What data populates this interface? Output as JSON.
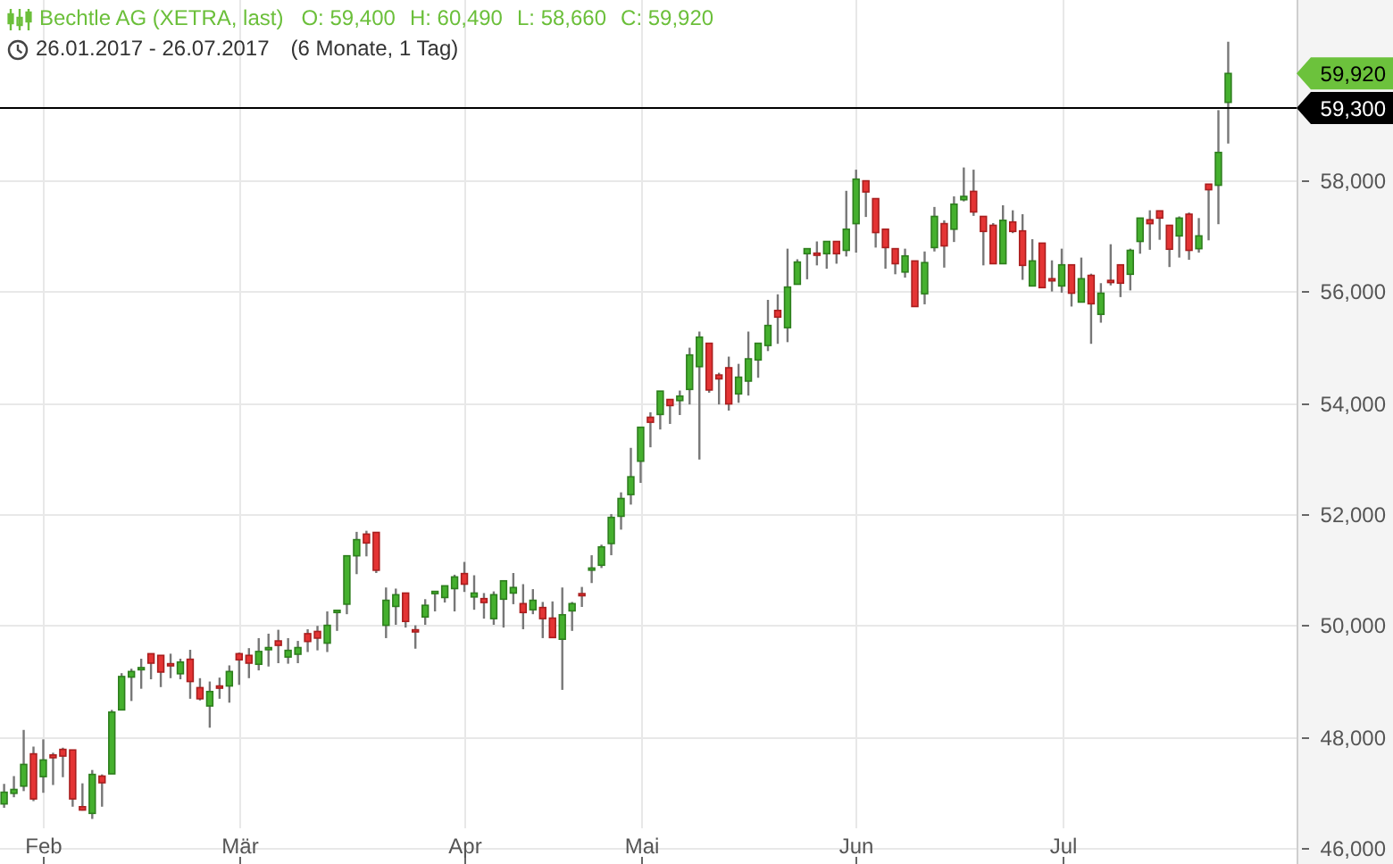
{
  "header": {
    "title": "Bechtle AG (XETRA, last)",
    "quotes": [
      "O: 59,400",
      "H: 60,490",
      "L: 58,660",
      "C: 59,920"
    ],
    "range": "26.01.2017 - 26.07.2017",
    "period": "(6 Monate, 1 Tag)"
  },
  "chart": {
    "chart_data": {
      "type": "candlestick",
      "grid": true,
      "ylim": [
        45710,
        61240
      ],
      "yticks": [
        {
          "value": 46000,
          "label": "46,000"
        },
        {
          "value": 48000,
          "label": "48,000"
        },
        {
          "value": 50000,
          "label": "50,000"
        },
        {
          "value": 52000,
          "label": "52,000"
        },
        {
          "value": 54000,
          "label": "54,000"
        },
        {
          "value": 56000,
          "label": "56,000"
        },
        {
          "value": 58000,
          "label": "58,000"
        }
      ],
      "categories": [
        null,
        null,
        null,
        null,
        "Feb",
        null,
        null,
        null,
        null,
        null,
        null,
        null,
        null,
        null,
        null,
        null,
        null,
        null,
        null,
        null,
        null,
        null,
        null,
        null,
        "Mär",
        null,
        null,
        null,
        null,
        null,
        null,
        null,
        null,
        null,
        null,
        null,
        null,
        null,
        null,
        null,
        null,
        null,
        null,
        null,
        null,
        null,
        null,
        "Apr",
        null,
        null,
        null,
        null,
        null,
        null,
        null,
        null,
        null,
        null,
        null,
        null,
        null,
        null,
        null,
        null,
        null,
        "Mai",
        null,
        null,
        null,
        null,
        null,
        null,
        null,
        null,
        null,
        null,
        null,
        null,
        null,
        null,
        null,
        null,
        null,
        null,
        null,
        null,
        null,
        "Jun",
        null,
        null,
        null,
        null,
        null,
        null,
        null,
        null,
        null,
        null,
        null,
        null,
        null,
        null,
        null,
        null,
        null,
        null,
        null,
        null,
        "Jul",
        null,
        null,
        null,
        null,
        null,
        null,
        null,
        null,
        null,
        null,
        null,
        null,
        null,
        null,
        null,
        null,
        null
      ],
      "ohlc": [
        [
          46790,
          47150,
          46720,
          47000
        ],
        [
          46980,
          47290,
          46910,
          47050
        ],
        [
          47110,
          48120,
          47020,
          47500
        ],
        [
          47690,
          47820,
          46840,
          46880
        ],
        [
          47280,
          47950,
          46990,
          47580
        ],
        [
          47670,
          47710,
          47130,
          47620
        ],
        [
          47770,
          47800,
          47270,
          47650
        ],
        [
          47760,
          47760,
          46740,
          46880
        ],
        [
          46740,
          47160,
          46670,
          46680
        ],
        [
          46620,
          47400,
          46520,
          47320
        ],
        [
          47290,
          47320,
          46740,
          47170
        ],
        [
          47330,
          48480,
          47330,
          48440
        ],
        [
          48480,
          49140,
          48480,
          49080
        ],
        [
          49070,
          49220,
          48640,
          49170
        ],
        [
          49220,
          49400,
          48860,
          49240
        ],
        [
          49490,
          49490,
          49030,
          49320
        ],
        [
          49460,
          49460,
          48890,
          49160
        ],
        [
          49310,
          49490,
          49050,
          49290
        ],
        [
          49130,
          49400,
          49030,
          49340
        ],
        [
          49390,
          49560,
          48680,
          48990
        ],
        [
          48880,
          49050,
          48650,
          48680
        ],
        [
          48550,
          48990,
          48160,
          48810
        ],
        [
          48910,
          49060,
          48680,
          48870
        ],
        [
          48910,
          49280,
          48610,
          49170
        ],
        [
          49490,
          49510,
          48930,
          49380
        ],
        [
          49460,
          49590,
          49050,
          49320
        ],
        [
          49300,
          49770,
          49190,
          49530
        ],
        [
          49580,
          49850,
          49260,
          49600
        ],
        [
          49720,
          49920,
          49320,
          49640
        ],
        [
          49430,
          49770,
          49310,
          49550
        ],
        [
          49480,
          49720,
          49320,
          49600
        ],
        [
          49850,
          49930,
          49520,
          49710
        ],
        [
          49890,
          49990,
          49550,
          49770
        ],
        [
          49680,
          50250,
          49520,
          50000
        ],
        [
          50230,
          50270,
          49900,
          50270
        ],
        [
          50380,
          51250,
          50200,
          51250
        ],
        [
          51250,
          51680,
          50920,
          51540
        ],
        [
          51640,
          51700,
          51240,
          51480
        ],
        [
          51670,
          51670,
          50940,
          50990
        ],
        [
          50000,
          50680,
          49770,
          50450
        ],
        [
          50340,
          50660,
          50010,
          50550
        ],
        [
          50580,
          50580,
          49960,
          50070
        ],
        [
          49920,
          50000,
          49580,
          49900
        ],
        [
          50150,
          50470,
          50010,
          50360
        ],
        [
          50570,
          50610,
          50250,
          50610
        ],
        [
          50500,
          50710,
          50410,
          50710
        ],
        [
          50660,
          50910,
          50250,
          50870
        ],
        [
          50930,
          51140,
          50600,
          50740
        ],
        [
          50510,
          50900,
          50280,
          50580
        ],
        [
          50480,
          50580,
          50120,
          50410
        ],
        [
          50120,
          50610,
          50010,
          50550
        ],
        [
          50470,
          50800,
          49960,
          50800
        ],
        [
          50580,
          50940,
          50380,
          50680
        ],
        [
          50390,
          50740,
          49930,
          50230
        ],
        [
          50280,
          50650,
          50200,
          50450
        ],
        [
          50320,
          50420,
          49770,
          50120
        ],
        [
          50130,
          50430,
          49780,
          49780
        ],
        [
          49750,
          50680,
          48840,
          50190
        ],
        [
          50260,
          50420,
          49900,
          50390
        ],
        [
          50570,
          50690,
          50330,
          50550
        ],
        [
          51000,
          51260,
          50760,
          51030
        ],
        [
          51080,
          51450,
          51030,
          51410
        ],
        [
          51470,
          52000,
          51260,
          51940
        ],
        [
          51960,
          52390,
          51720,
          52280
        ],
        [
          52350,
          53190,
          52170,
          52670
        ],
        [
          52950,
          53560,
          52560,
          53560
        ],
        [
          53740,
          53830,
          53200,
          53650
        ],
        [
          53790,
          54210,
          53520,
          54210
        ],
        [
          54060,
          54060,
          53620,
          53950
        ],
        [
          54040,
          54220,
          53780,
          54120
        ],
        [
          54240,
          54990,
          53970,
          54860
        ],
        [
          54650,
          55280,
          52980,
          55180
        ],
        [
          55070,
          55070,
          54180,
          54230
        ],
        [
          54500,
          54540,
          53970,
          54430
        ],
        [
          54630,
          54830,
          53860,
          53980
        ],
        [
          54160,
          54700,
          54000,
          54460
        ],
        [
          54390,
          55280,
          54130,
          54790
        ],
        [
          54770,
          55070,
          54450,
          55070
        ],
        [
          55030,
          55850,
          54930,
          55390
        ],
        [
          55660,
          55950,
          55060,
          55540
        ],
        [
          55350,
          56770,
          55090,
          56080
        ],
        [
          56130,
          56580,
          56130,
          56530
        ],
        [
          56680,
          56770,
          56220,
          56770
        ],
        [
          56690,
          56900,
          56470,
          56670
        ],
        [
          56680,
          56900,
          56410,
          56900
        ],
        [
          56900,
          56900,
          56500,
          56680
        ],
        [
          56740,
          57810,
          56630,
          57120
        ],
        [
          57220,
          58190,
          56700,
          58020
        ],
        [
          57990,
          57990,
          57340,
          57790
        ],
        [
          57670,
          57670,
          56790,
          57060
        ],
        [
          57120,
          57120,
          56410,
          56790
        ],
        [
          56770,
          56770,
          56310,
          56500
        ],
        [
          56350,
          56770,
          56250,
          56640
        ],
        [
          56550,
          56550,
          55730,
          55730
        ],
        [
          55960,
          56720,
          55770,
          56520
        ],
        [
          56790,
          57520,
          56720,
          57350
        ],
        [
          57220,
          57280,
          56430,
          56820
        ],
        [
          57120,
          57710,
          56890,
          57570
        ],
        [
          57650,
          58230,
          57620,
          57710
        ],
        [
          57800,
          58190,
          57360,
          57430
        ],
        [
          57350,
          57350,
          56470,
          57080
        ],
        [
          57190,
          57230,
          56500,
          56500
        ],
        [
          56500,
          57550,
          56500,
          57280
        ],
        [
          57250,
          57460,
          57050,
          57080
        ],
        [
          57090,
          57390,
          56210,
          56470
        ],
        [
          56100,
          56940,
          56100,
          56550
        ],
        [
          56870,
          56870,
          56070,
          56070
        ],
        [
          56230,
          56560,
          56000,
          56220
        ],
        [
          56100,
          56770,
          55980,
          56480
        ],
        [
          56480,
          56480,
          55730,
          55970
        ],
        [
          55810,
          56610,
          55810,
          56230
        ],
        [
          56290,
          56320,
          55060,
          55780
        ],
        [
          55590,
          56150,
          55440,
          55970
        ],
        [
          56200,
          56850,
          56110,
          56190
        ],
        [
          56480,
          56480,
          55900,
          56150
        ],
        [
          56310,
          56770,
          56020,
          56740
        ],
        [
          56900,
          57320,
          56680,
          57320
        ],
        [
          57290,
          57460,
          56750,
          57220
        ],
        [
          57450,
          57450,
          56930,
          57320
        ],
        [
          57190,
          57190,
          56440,
          56760
        ],
        [
          57000,
          57350,
          56610,
          57320
        ],
        [
          57390,
          57420,
          56570,
          56740
        ],
        [
          56770,
          57320,
          56700,
          57000
        ],
        [
          57930,
          57930,
          56920,
          57830
        ],
        [
          57910,
          59260,
          57210,
          58500
        ],
        [
          59400,
          60490,
          58660,
          59920
        ]
      ],
      "annotations": [
        "59,920"
      ],
      "ref_lines": [
        {
          "axis": "y",
          "value": 59300,
          "label": "59,300"
        }
      ]
    }
  }
}
